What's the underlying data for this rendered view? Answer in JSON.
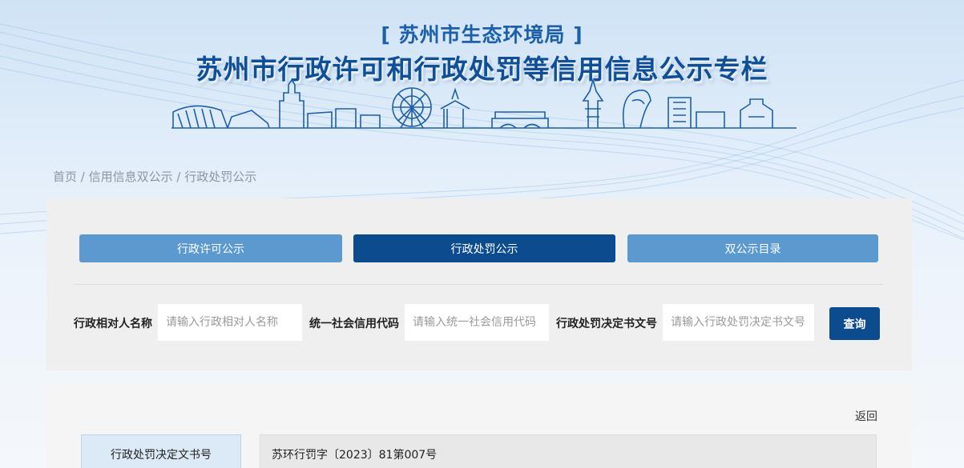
{
  "header": {
    "org": "[ 苏州市生态环境局 ]",
    "title": "苏州市行政许可和行政处罚等信用信息公示专栏"
  },
  "breadcrumb": {
    "home": "首页",
    "sep1": " / ",
    "level2": "信用信息双公示",
    "sep2": " / ",
    "current": "行政处罚公示"
  },
  "tabs": [
    {
      "label": "行政许可公示",
      "active": false
    },
    {
      "label": "行政处罚公示",
      "active": true
    },
    {
      "label": "双公示目录",
      "active": false
    }
  ],
  "search": {
    "fields": [
      {
        "label": "行政相对人名称",
        "placeholder": "请输入行政相对人名称",
        "value": ""
      },
      {
        "label": "统一社会信用代码",
        "placeholder": "请输入统一社会信用代码",
        "value": ""
      },
      {
        "label": "行政处罚决定书文号",
        "placeholder": "请输入行政处罚决定书文号",
        "value": ""
      }
    ],
    "button": "查询"
  },
  "detail": {
    "back": "返回",
    "rows": [
      {
        "label": "行政处罚决定文书号",
        "value": "苏环行罚字〔2023〕81第007号"
      }
    ]
  },
  "colors": {
    "primary": "#0c4c8e",
    "tab": "#5b99cf",
    "title": "#0f4f98"
  }
}
